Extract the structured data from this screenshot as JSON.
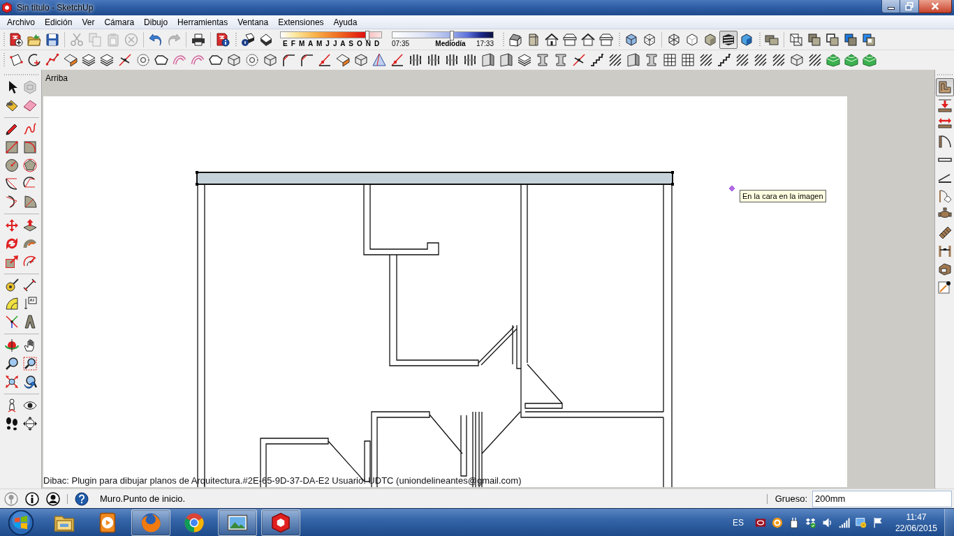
{
  "window": {
    "title": "Sin título - SketchUp"
  },
  "menu": [
    "Archivo",
    "Edición",
    "Ver",
    "Cámara",
    "Dibujo",
    "Herramientas",
    "Ventana",
    "Extensiones",
    "Ayuda"
  ],
  "standard_toolbar": [
    {
      "disabled": false
    },
    {
      "disabled": false
    },
    {
      "disabled": false
    },
    {
      "disabled": true
    },
    {
      "disabled": true
    },
    {
      "disabled": true
    },
    {
      "disabled": true
    },
    {
      "disabled": false
    },
    {
      "disabled": true
    },
    {
      "disabled": false
    },
    {
      "disabled": false
    }
  ],
  "shadow_settings": {
    "month_slider": {
      "labels": "E F M A M J J A S O N D",
      "level": 0.86
    },
    "time_slider": {
      "start": "07:35",
      "middle": "Mediodía",
      "end": "17:33",
      "level": 0.59
    }
  },
  "style_toolbar": [
    {
      "selected": false
    },
    {
      "selected": false
    },
    {
      "selected": false
    },
    {
      "selected": false
    },
    {
      "selected": false
    },
    {
      "selected": true
    },
    {
      "selected": false
    }
  ],
  "dibac_toolbar": [
    {
      "selected": true
    },
    {
      "selected": false
    },
    {
      "selected": false
    },
    {
      "selected": false
    },
    {
      "selected": false
    },
    {
      "selected": false
    },
    {
      "selected": false
    },
    {
      "selected": false
    },
    {
      "selected": false
    },
    {
      "selected": false
    },
    {
      "selected": false
    },
    {
      "selected": false
    }
  ],
  "viewport": {
    "view_name": "Arriba",
    "tooltip": "En la cara en la imagen",
    "plugin_notice": "Dibac: Plugin para dibujar planos de Arquitectura.#2E-65-9D-37-DA-E2 Usuario: UDTC (uniondelineantes@gmail.com)"
  },
  "status_bar": {
    "message": "Muro.Punto de inicio.",
    "measurement_label": "Grueso:",
    "measurement_value": "200mm"
  },
  "taskbar": {
    "apps": [
      {
        "running": false
      },
      {
        "running": false
      },
      {
        "running": true
      },
      {
        "running": false
      },
      {
        "running": true
      },
      {
        "running": true
      }
    ],
    "language": "ES",
    "time": "11:47",
    "date": "22/06/2015"
  }
}
